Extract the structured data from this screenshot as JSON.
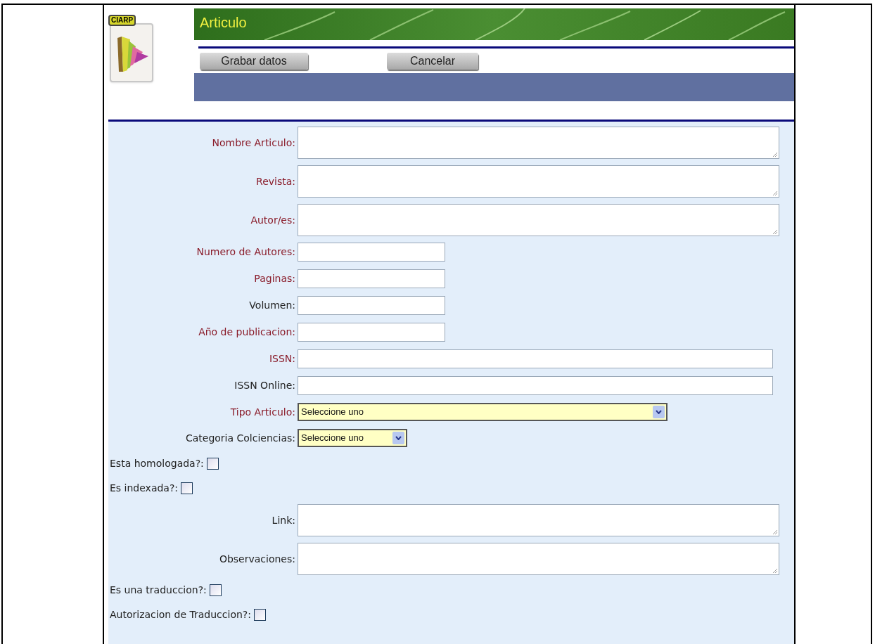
{
  "logo": {
    "badge": "CIARP"
  },
  "header": {
    "title": "Articulo"
  },
  "buttons": [
    "Grabar datos",
    "Cancelar"
  ],
  "fields": [
    {
      "kind": "textarea",
      "label": "Nombre Articulo:",
      "required": true
    },
    {
      "kind": "textarea",
      "label": "Revista:",
      "required": true
    },
    {
      "kind": "textarea",
      "label": "Autor/es:",
      "required": true
    },
    {
      "kind": "short",
      "label": "Numero de Autores:",
      "required": true
    },
    {
      "kind": "short",
      "label": "Paginas:",
      "required": true
    },
    {
      "kind": "short",
      "label": "Volumen:",
      "required": false
    },
    {
      "kind": "short",
      "label": "Año de publicacion:",
      "required": true
    },
    {
      "kind": "long",
      "label": "ISSN:",
      "required": true
    },
    {
      "kind": "long",
      "label": "ISSN Online:",
      "required": false
    },
    {
      "kind": "select_wide",
      "label": "Tipo Articulo:",
      "required": true,
      "value": "Seleccione uno"
    },
    {
      "kind": "select",
      "label": "Categoria Colciencias:",
      "required": false,
      "value": "Seleccione uno"
    },
    {
      "kind": "checkbox",
      "label": "Esta homologada?:",
      "checked": false
    },
    {
      "kind": "checkbox",
      "label": "Es indexada?:",
      "checked": false
    },
    {
      "kind": "textarea",
      "label": "Link:",
      "required": false
    },
    {
      "kind": "textarea",
      "label": "Observaciones:",
      "required": false
    },
    {
      "kind": "checkbox",
      "label": "Es una traduccion?:",
      "checked": false
    },
    {
      "kind": "checkbox",
      "label": "Autorizacion de Traduccion?:",
      "checked": false
    }
  ]
}
